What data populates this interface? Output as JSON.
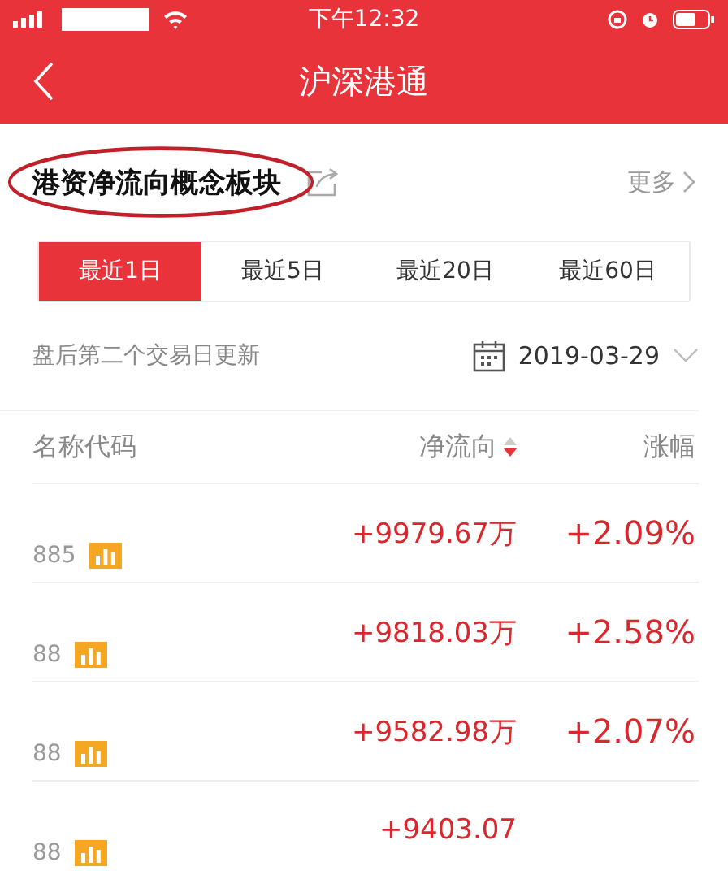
{
  "status_bar": {
    "time": "下午12:32"
  },
  "nav": {
    "title": "沪深港通"
  },
  "section": {
    "title": "港资净流向概念板块",
    "annotated": true,
    "more": "更多"
  },
  "tabs": [
    {
      "label": "最近1日",
      "selected": true
    },
    {
      "label": "最近5日",
      "selected": false
    },
    {
      "label": "最近20日",
      "selected": false
    },
    {
      "label": "最近60日",
      "selected": false
    }
  ],
  "update_note": "盘后第二个交易日更新",
  "date": "2019-03-29",
  "table": {
    "columns": [
      "名称代码",
      "净流向",
      "涨幅"
    ],
    "rows": [
      {
        "code": "885",
        "net_flow": "+9979.67万",
        "change": "+2.09%"
      },
      {
        "code": "88",
        "net_flow": "+9818.03万",
        "change": "+2.58%"
      },
      {
        "code": "88",
        "net_flow": "+9582.98万",
        "change": "+2.07%"
      },
      {
        "code": "88",
        "net_flow": "+9403.07"
      }
    ]
  }
}
